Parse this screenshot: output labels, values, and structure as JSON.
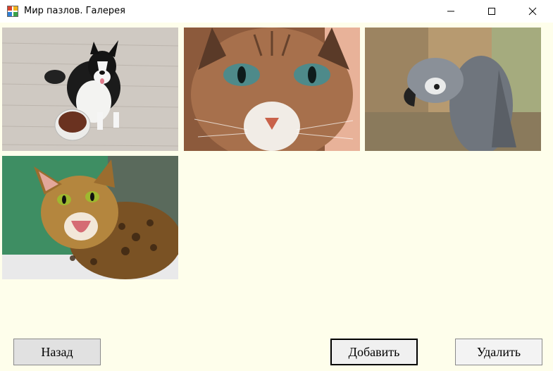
{
  "window": {
    "title": "Мир пазлов. Галерея"
  },
  "gallery": {
    "images": [
      {
        "subject": "dog-with-food-bowl"
      },
      {
        "subject": "cat-face-closeup"
      },
      {
        "subject": "grey-parrot"
      },
      {
        "subject": "bengal-cat-meowing"
      }
    ]
  },
  "buttons": {
    "back": "Назад",
    "add": "Добавить",
    "delete": "Удалить"
  },
  "colors": {
    "client_background": "#fefeeb",
    "button_face": "#e1e1e1"
  }
}
